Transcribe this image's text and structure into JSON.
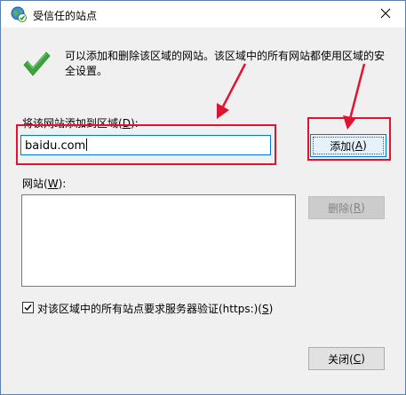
{
  "window": {
    "title": "受信任的站点",
    "close_glyph": "✕"
  },
  "info": {
    "text": "可以添加和删除该区域的网站。该区域中的所有网站都使用区域的安全设置。"
  },
  "add_section": {
    "label_prefix": "将该网站添加到区域(",
    "label_key": "D",
    "label_suffix": "):",
    "input_value": "baidu.com",
    "add_button_prefix": "添加(",
    "add_button_key": "A",
    "add_button_suffix": ")"
  },
  "sites_section": {
    "label_prefix": "网站(",
    "label_key": "W",
    "label_suffix": "):",
    "items": [],
    "remove_button_prefix": "删除(",
    "remove_button_key": "R",
    "remove_button_suffix": ")"
  },
  "https_option": {
    "checked": true,
    "label_prefix": "对该区域中的所有站点要求服务器验证(https:)(",
    "label_key": "S",
    "label_suffix": ")"
  },
  "footer": {
    "close_button_prefix": "关闭(",
    "close_button_key": "C",
    "close_button_suffix": ")"
  },
  "colors": {
    "annotation_red": "#e0142f",
    "focus_blue": "#0078d7",
    "check_green": "#3aa53a"
  },
  "icons": {
    "title": "globe-check-icon",
    "info": "green-check-icon",
    "close": "close-icon"
  }
}
